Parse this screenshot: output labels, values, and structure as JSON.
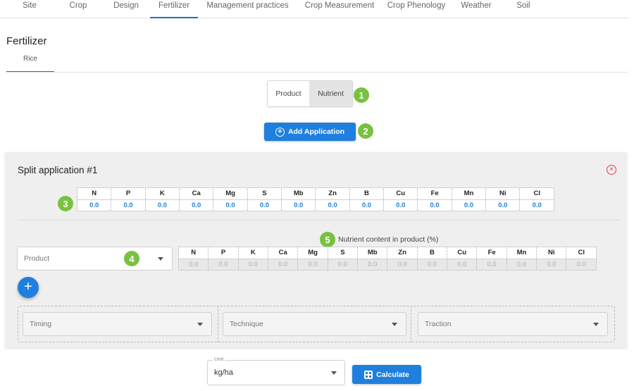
{
  "nav": {
    "tabs": [
      "Site",
      "Crop",
      "Design",
      "Fertilizer",
      "Management practices",
      "Crop Measurement",
      "Crop Phenology",
      "Weather",
      "Soil"
    ],
    "active_index": 3
  },
  "page": {
    "title": "Fertilizer",
    "subtab": "Rice"
  },
  "toggle": {
    "product_label": "Product",
    "nutrient_label": "Nutrient",
    "selected": "Nutrient"
  },
  "badges": [
    "1",
    "2",
    "3",
    "4",
    "5"
  ],
  "add_application_label": "Add Application",
  "split": {
    "title": "Split application #1",
    "nutrients": [
      "N",
      "P",
      "K",
      "Ca",
      "Mg",
      "S",
      "Mb",
      "Zn",
      "B",
      "Cu",
      "Fe",
      "Mn",
      "Ni",
      "Cl"
    ],
    "values": [
      "0.0",
      "0.0",
      "0.0",
      "0.0",
      "0.0",
      "0.0",
      "0.0",
      "0.0",
      "0.0",
      "0.0",
      "0.0",
      "0.0",
      "0.0",
      "0.0"
    ],
    "nutrient_content_label": "Nutrient content in product (%)",
    "product_placeholder": "Product",
    "product_values": [
      "0.0",
      "0.0",
      "0.0",
      "0.0",
      "0.0",
      "0.0",
      "0.0",
      "0.0",
      "0.0",
      "0.0",
      "0.0",
      "0.0",
      "0.0",
      "0.0"
    ],
    "add_product_label": "+",
    "timing_placeholder": "Timing",
    "technique_placeholder": "Technique",
    "traction_placeholder": "Traction"
  },
  "unit": {
    "caption": "Unit",
    "value": "kg/ha"
  },
  "calculate_label": "Calculate",
  "colors": {
    "accent": "#1f7fde",
    "badge": "#7ac142",
    "close": "#e03a4c"
  }
}
